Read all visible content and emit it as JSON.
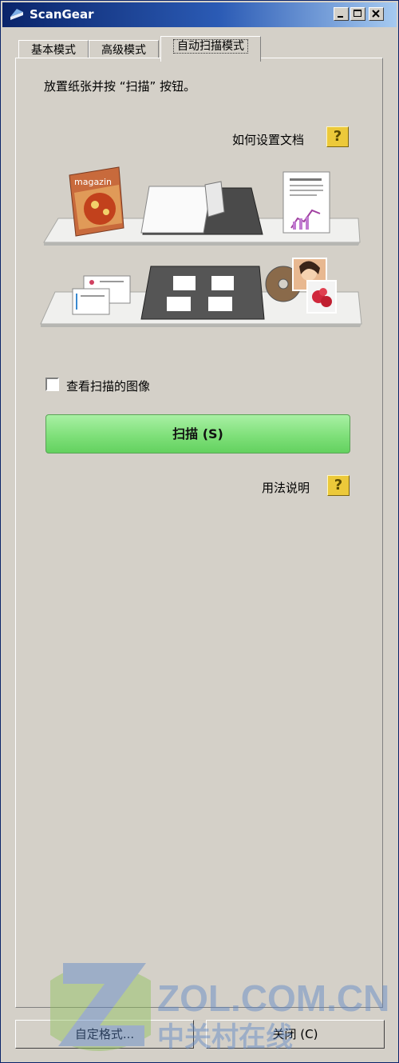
{
  "window": {
    "title": "ScanGear"
  },
  "tabs": [
    {
      "label": "基本模式"
    },
    {
      "label": "高级模式"
    },
    {
      "label": "自动扫描模式"
    }
  ],
  "panel": {
    "instruction": "放置纸张并按 “扫描” 按钮。",
    "doc_setup_link": "如何设置文档",
    "view_checkbox_label": "查看扫描的图像",
    "scan_button_label": "扫描 (S)",
    "usage_link": "用法说明",
    "magazine_text": "magazin"
  },
  "footer": {
    "customize_label": "自定格式...",
    "close_label": "关闭 (C)"
  },
  "watermark": {
    "text_latin": "ZOL.COM.CN",
    "text_cn": "中关村在线"
  },
  "colors": {
    "title_start": "#0a246a",
    "title_end": "#a6caf0",
    "scan_button": "#7fe07a",
    "help_button": "#ecc93a",
    "window_bg": "#d4d0c8"
  }
}
